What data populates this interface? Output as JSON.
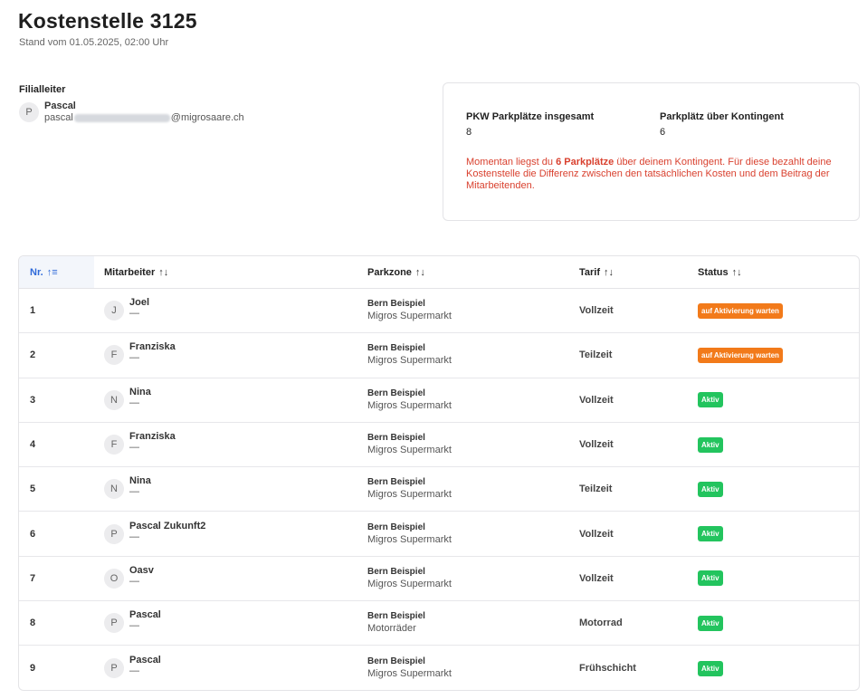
{
  "header": {
    "title": "Kostenstelle 3125",
    "subtitle": "Stand vom 01.05.2025, 02:00 Uhr"
  },
  "manager": {
    "heading": "Filialleiter",
    "initial": "P",
    "name": "Pascal",
    "email_prefix": "pascal",
    "email_suffix": "@migrosaare.ch"
  },
  "summary": {
    "total_label": "PKW Parkplätze insgesamt",
    "total_value": "8",
    "over_label": "Parkplätz über Kontingent",
    "over_value": "6",
    "note_pre": "Momentan liegst du ",
    "note_bold": "6 Parkplätze",
    "note_post": " über deinem Kontingent. Für diese bezahlt deine Kostenstelle die Differenz zwischen den tatsächlichen Kosten und dem Beitrag der Mitarbeitenden."
  },
  "table": {
    "columns": {
      "nr": "Nr.",
      "employee": "Mitarbeiter",
      "zone": "Parkzone",
      "tarif": "Tarif",
      "status": "Status"
    },
    "sort_icons": {
      "active": "↑≡",
      "inactive": "↑↓"
    },
    "rows": [
      {
        "nr": "1",
        "initial": "J",
        "name": "Joel",
        "sub": "—",
        "zone": "Bern Beispiel",
        "zone_sub": "Migros Supermarkt",
        "tarif": "Vollzeit",
        "status": "auf Aktivierung warten",
        "status_type": "waiting"
      },
      {
        "nr": "2",
        "initial": "F",
        "name": "Franziska",
        "sub": "—",
        "zone": "Bern Beispiel",
        "zone_sub": "Migros Supermarkt",
        "tarif": "Teilzeit",
        "status": "auf Aktivierung warten",
        "status_type": "waiting"
      },
      {
        "nr": "3",
        "initial": "N",
        "name": "Nina",
        "sub": "—",
        "zone": "Bern Beispiel",
        "zone_sub": "Migros Supermarkt",
        "tarif": "Vollzeit",
        "status": "Aktiv",
        "status_type": "active"
      },
      {
        "nr": "4",
        "initial": "F",
        "name": "Franziska",
        "sub": "—",
        "zone": "Bern Beispiel",
        "zone_sub": "Migros Supermarkt",
        "tarif": "Vollzeit",
        "status": "Aktiv",
        "status_type": "active"
      },
      {
        "nr": "5",
        "initial": "N",
        "name": "Nina",
        "sub": "—",
        "zone": "Bern Beispiel",
        "zone_sub": "Migros Supermarkt",
        "tarif": "Teilzeit",
        "status": "Aktiv",
        "status_type": "active"
      },
      {
        "nr": "6",
        "initial": "P",
        "name": "Pascal Zukunft2",
        "sub": "—",
        "zone": "Bern Beispiel",
        "zone_sub": "Migros Supermarkt",
        "tarif": "Vollzeit",
        "status": "Aktiv",
        "status_type": "active"
      },
      {
        "nr": "7",
        "initial": "O",
        "name": "Oasv",
        "sub": "—",
        "zone": "Bern Beispiel",
        "zone_sub": "Migros Supermarkt",
        "tarif": "Vollzeit",
        "status": "Aktiv",
        "status_type": "active"
      },
      {
        "nr": "8",
        "initial": "P",
        "name": "Pascal",
        "sub": "—",
        "zone": "Bern Beispiel",
        "zone_sub": "Motorräder",
        "tarif": "Motorrad",
        "status": "Aktiv",
        "status_type": "active"
      },
      {
        "nr": "9",
        "initial": "P",
        "name": "Pascal",
        "sub": "—",
        "zone": "Bern Beispiel",
        "zone_sub": "Migros Supermarkt",
        "tarif": "Frühschicht",
        "status": "Aktiv",
        "status_type": "active"
      }
    ]
  },
  "colors": {
    "accent": "#2f6ad9",
    "warning_text": "#d9412f",
    "badge_waiting": "#f27a1a",
    "badge_active": "#23c45e"
  }
}
